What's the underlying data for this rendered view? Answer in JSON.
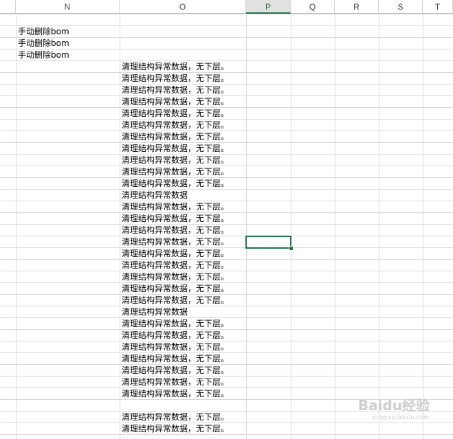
{
  "sheet": {
    "columns": [
      "N",
      "O",
      "P",
      "Q",
      "R",
      "S",
      "T"
    ],
    "active_column": "P",
    "colors": {
      "grid": "#d9d9d9",
      "selection": "#217346",
      "header_text": "#444444"
    }
  },
  "cells": {
    "n": [
      "手动删除bom",
      "手动删除bom",
      "手动删除bom"
    ],
    "o": [
      "清理结构异常数据，无下层。",
      "清理结构异常数据，无下层。",
      "清理结构异常数据，无下层。",
      "清理结构异常数据，无下层。",
      "清理结构异常数据，无下层。",
      "清理结构异常数据，无下层。",
      "清理结构异常数据，无下层。",
      "清理结构异常数据，无下层。",
      "清理结构异常数据，无下层。",
      "清理结构异常数据，无下层。",
      "清理结构异常数据，无下层。",
      "清理结构异常数据",
      "清理结构异常数据，无下层。",
      "清理结构异常数据，无下层。",
      "清理结构异常数据，无下层。",
      "清理结构异常数据，无下层。",
      "清理结构异常数据，无下层。",
      "清理结构异常数据，无下层。",
      "清理结构异常数据，无下层。",
      "清理结构异常数据，无下层。",
      "清理结构异常数据，无下层。",
      "清理结构异常数据",
      "清理结构异常数据，无下层。",
      "清理结构异常数据，无下层。",
      "清理结构异常数据，无下层。",
      "清理结构异常数据，无下层。",
      "清理结构异常数据，无下层。",
      "清理结构异常数据，无下层。",
      "清理结构异常数据，无下层。",
      "",
      "清理结构异常数据，无下层。",
      "清理结构异常数据，无下层。"
    ]
  },
  "watermark": {
    "text": "Baidu经验",
    "sub": "jingyan.baidu.com"
  }
}
